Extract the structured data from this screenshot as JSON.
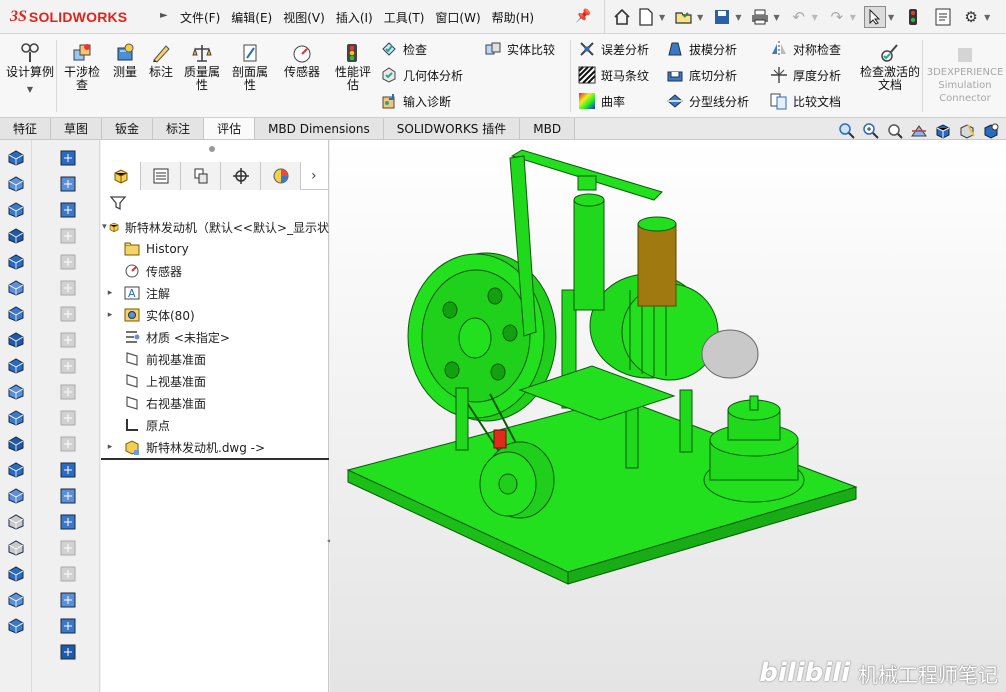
{
  "app": {
    "logo_ds": "3S",
    "logo_text": "SOLIDWORKS"
  },
  "menu": [
    "文件(F)",
    "编辑(E)",
    "视图(V)",
    "插入(I)",
    "工具(T)",
    "窗口(W)",
    "帮助(H)"
  ],
  "quick_access": [
    "home-icon",
    "new-doc-icon",
    "open-icon",
    "save-icon",
    "print-icon",
    "undo-icon",
    "redo-icon",
    "select-arrow-icon",
    "traffic-light-icon",
    "file-properties-icon",
    "options-gear-icon"
  ],
  "ribbon": {
    "big_buttons": [
      "设计算例",
      "干涉检查",
      "测量",
      "标注",
      "质量属性",
      "剖面属性",
      "传感器",
      "性能评估"
    ],
    "small_col1": [
      "检查",
      "几何体分析",
      "输入诊断"
    ],
    "small_col1b": [
      "实体比较"
    ],
    "small_col2": [
      "误差分析",
      "斑马条纹",
      "曲率"
    ],
    "small_col3": [
      "拔模分析",
      "底切分析",
      "分型线分析"
    ],
    "small_col4": [
      "对称检查",
      "厚度分析",
      "比较文档"
    ],
    "activate_check": "检查激活的文档",
    "xp_line1": "3DEXPERIENCE",
    "xp_line2": "Simulation",
    "xp_line3": "Connector"
  },
  "tabs": [
    "特征",
    "草图",
    "钣金",
    "标注",
    "评估",
    "MBD Dimensions",
    "SOLIDWORKS 插件",
    "MBD"
  ],
  "active_tab": "评估",
  "feature_tree": {
    "root": "斯特林发动机（默认<<默认>_显示状",
    "items": [
      {
        "label": "History",
        "expandable": false,
        "icon": "history-folder-icon"
      },
      {
        "label": "传感器",
        "expandable": false,
        "icon": "sensor-icon"
      },
      {
        "label": "注解",
        "expandable": true,
        "icon": "annotation-icon"
      },
      {
        "label": "实体(80)",
        "expandable": true,
        "icon": "solid-bodies-icon"
      },
      {
        "label": "材质 <未指定>",
        "expandable": false,
        "icon": "material-icon"
      },
      {
        "label": "前视基准面",
        "expandable": false,
        "icon": "plane-icon"
      },
      {
        "label": "上视基准面",
        "expandable": false,
        "icon": "plane-icon"
      },
      {
        "label": "右视基准面",
        "expandable": false,
        "icon": "plane-icon"
      },
      {
        "label": "原点",
        "expandable": false,
        "icon": "origin-icon"
      },
      {
        "label": "斯特林发动机.dwg ->",
        "expandable": true,
        "icon": "part-dwg-icon"
      }
    ]
  },
  "watermark": {
    "brand": "bilibili",
    "text": "机械工程师笔记"
  },
  "colors": {
    "model_green": "#22e01e",
    "model_edge": "#0a5a08",
    "brass": "#a07a10",
    "brand_red": "#e2231a",
    "accent_blue": "#2b6cb5"
  }
}
